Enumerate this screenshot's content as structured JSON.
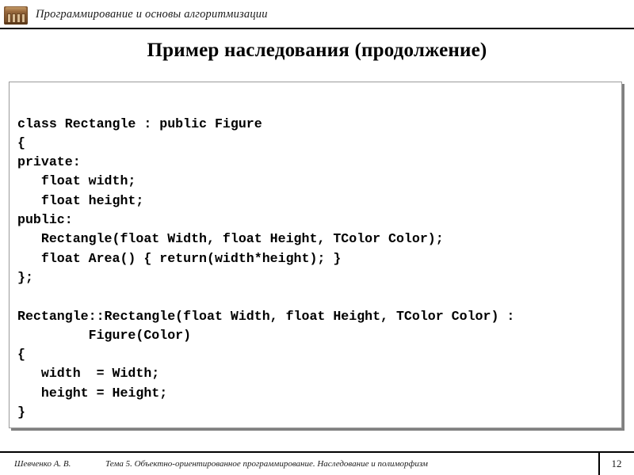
{
  "header": {
    "icon": "building-icon",
    "title": "Программирование и основы алгоритмизации"
  },
  "slide": {
    "title": "Пример наследования (продолжение)",
    "code": "class Rectangle : public Figure\n{\nprivate:\n   float width;\n   float height;\npublic:\n   Rectangle(float Width, float Height, TColor Color);\n   float Area() { return(width*height); }\n};\n\nRectangle::Rectangle(float Width, float Height, TColor Color) :\n         Figure(Color)\n{\n   width  = Width;\n   height = Height;\n}"
  },
  "footer": {
    "author": "Шевченко А. В.",
    "topic": "Тема 5. Объектно-ориентированное программирование. Наследование и полиморфизм",
    "page": "12"
  }
}
